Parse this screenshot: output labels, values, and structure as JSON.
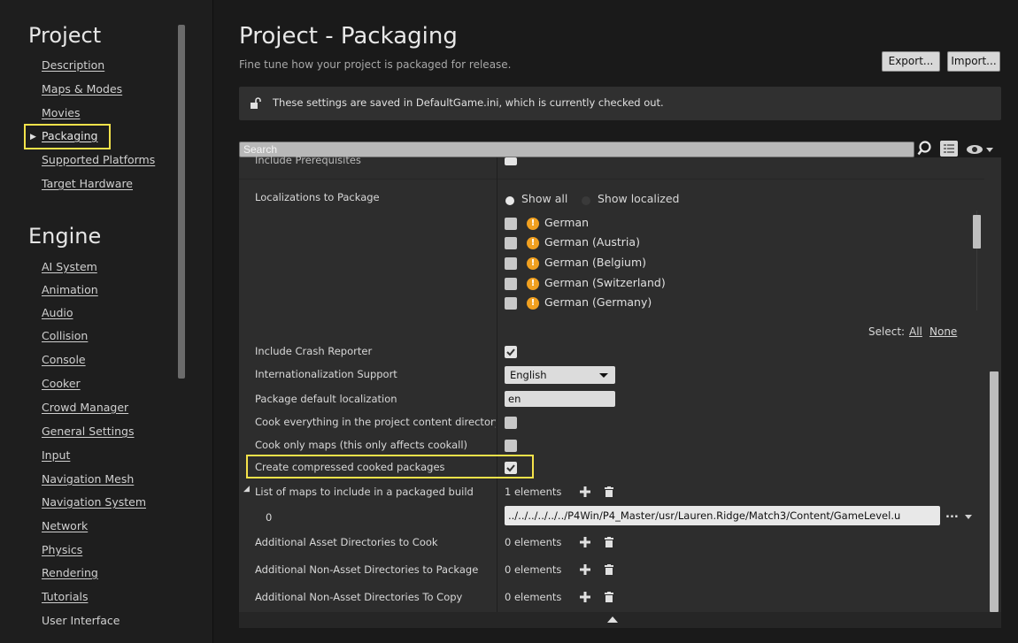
{
  "sidebar": {
    "project_heading": "Project",
    "project_items": [
      {
        "label": "Description"
      },
      {
        "label": "Maps & Modes"
      },
      {
        "label": "Movies"
      },
      {
        "label": "Packaging"
      },
      {
        "label": "Supported Platforms"
      },
      {
        "label": "Target Hardware"
      }
    ],
    "engine_heading": "Engine",
    "engine_items": [
      {
        "label": "AI System"
      },
      {
        "label": "Animation"
      },
      {
        "label": "Audio"
      },
      {
        "label": "Collision"
      },
      {
        "label": "Console"
      },
      {
        "label": "Cooker"
      },
      {
        "label": "Crowd Manager"
      },
      {
        "label": "General Settings"
      },
      {
        "label": "Input"
      },
      {
        "label": "Navigation Mesh"
      },
      {
        "label": "Navigation System"
      },
      {
        "label": "Network"
      },
      {
        "label": "Physics"
      },
      {
        "label": "Rendering"
      },
      {
        "label": "Tutorials"
      },
      {
        "label": "User Interface"
      }
    ]
  },
  "header": {
    "title": "Project - Packaging",
    "subtitle": "Fine tune how your project is packaged for release.",
    "export_label": "Export...",
    "import_label": "Import..."
  },
  "notice": {
    "text": "These settings are saved in DefaultGame.ini, which is currently checked out."
  },
  "search": {
    "placeholder": "Search"
  },
  "panel": {
    "cut_off_row": "Include Prerequisites",
    "localizations_label": "Localizations to Package",
    "show_all_label": "Show all",
    "show_localized_label": "Show localized",
    "localizations": [
      {
        "name": "German"
      },
      {
        "name": "German (Austria)"
      },
      {
        "name": "German (Belgium)"
      },
      {
        "name": "German (Switzerland)"
      },
      {
        "name": "German (Germany)"
      }
    ],
    "select_label": "Select:",
    "select_all": "All",
    "select_none": "None",
    "rows": {
      "include_crash_reporter": "Include Crash Reporter",
      "internationalization_support": "Internationalization Support",
      "internationalization_value": "English",
      "package_default_localization": "Package default localization",
      "package_default_localization_value": "en",
      "cook_everything": "Cook everything in the project content directory (i",
      "cook_only_maps": "Cook only maps (this only affects cookall)",
      "create_compressed": "Create compressed cooked packages",
      "list_of_maps": "List of maps to include in a packaged build",
      "list_of_maps_count": "1 elements",
      "map_index": "0",
      "map_path": "../../../../../../P4Win/P4_Master/usr/Lauren.Ridge/Match3/Content/GameLevel.u",
      "additional_asset_dirs": "Additional Asset Directories to Cook",
      "additional_asset_dirs_count": "0 elements",
      "additional_non_asset_package": "Additional Non-Asset Directories to Package",
      "additional_non_asset_package_count": "0 elements",
      "additional_non_asset_copy": "Additional Non-Asset Directories To Copy",
      "additional_non_asset_copy_count": "0 elements"
    }
  },
  "colors": {
    "highlight": "#f5e24a",
    "warning": "#f0a020",
    "background": "#1a1a1a",
    "panel": "#2d2d2d"
  }
}
